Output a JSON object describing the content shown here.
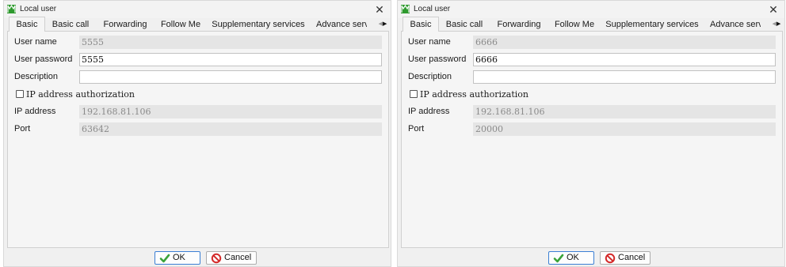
{
  "dialogs": [
    {
      "title": "Local user",
      "close_glyph": "✕",
      "tabs": [
        "Basic",
        "Basic call",
        "Forwarding",
        "Follow Me",
        "Supplementary services",
        "Advance serv"
      ],
      "active_tab": "Basic",
      "fields": {
        "user_name": {
          "label": "User name",
          "value": "5555"
        },
        "user_password": {
          "label": "User password",
          "value": "5555"
        },
        "description": {
          "label": "Description",
          "value": ""
        },
        "ip_auth": {
          "label": "IP address authorization",
          "checked": false
        },
        "ip_address": {
          "label": "IP address",
          "value": "192.168.81.106"
        },
        "port": {
          "label": "Port",
          "value": "63642"
        }
      },
      "buttons": {
        "ok": "OK",
        "cancel": "Cancel"
      }
    },
    {
      "title": "Local user",
      "close_glyph": "✕",
      "tabs": [
        "Basic",
        "Basic call",
        "Forwarding",
        "Follow Me",
        "Supplementary services",
        "Advance serv"
      ],
      "active_tab": "Basic",
      "fields": {
        "user_name": {
          "label": "User name",
          "value": "6666"
        },
        "user_password": {
          "label": "User password",
          "value": "6666"
        },
        "description": {
          "label": "Description",
          "value": ""
        },
        "ip_auth": {
          "label": "IP address authorization",
          "checked": false
        },
        "ip_address": {
          "label": "IP address",
          "value": "192.168.81.106"
        },
        "port": {
          "label": "Port",
          "value": "20000"
        }
      },
      "buttons": {
        "ok": "OK",
        "cancel": "Cancel"
      }
    }
  ],
  "icons": {
    "app": "app-logo-icon",
    "close": "close-icon",
    "ok": "checkmark-icon",
    "cancel": "cancel-icon",
    "tab_scroll_left": "chevron-left-icon",
    "tab_scroll_right": "chevron-right-icon"
  },
  "colors": {
    "app_icon_green": "#2e9a2e",
    "ok_check_green": "#3aa33a",
    "cancel_red": "#d42a2a",
    "ok_border_blue": "#3b7fd4"
  }
}
